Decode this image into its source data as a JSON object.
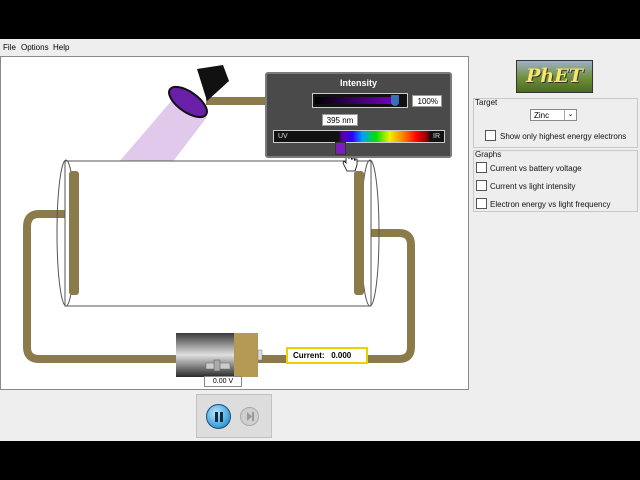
{
  "menu": {
    "items": [
      "File",
      "Options",
      "Help"
    ]
  },
  "logo": {
    "text": "PhET"
  },
  "intensity_panel": {
    "title": "Intensity",
    "intensity_value": "100%",
    "intensity_fraction": 1.0,
    "wavelength_value": "395 nm",
    "spectrum_uv_label": "UV",
    "spectrum_ir_label": "IR"
  },
  "circuit": {
    "current_label": "Current:",
    "current_value": "0.000",
    "battery_voltage": "0.00 V"
  },
  "side_panel": {
    "target_label": "Target",
    "target_value": "Zinc",
    "highest_energy_label": "Show only highest energy electrons",
    "graphs_label": "Graphs",
    "graphs": [
      "Current vs battery voltage",
      "Current vs light intensity",
      "Electron energy vs light frequency"
    ]
  },
  "colors": {
    "light_beam": "#d9b8e8",
    "wire": "#8b7b4a",
    "current_border": "#e6d300"
  },
  "icons": {
    "pause": "pause-icon",
    "step": "step-icon",
    "lamp": "lamp-icon",
    "cursor": "hand-cursor-icon"
  }
}
